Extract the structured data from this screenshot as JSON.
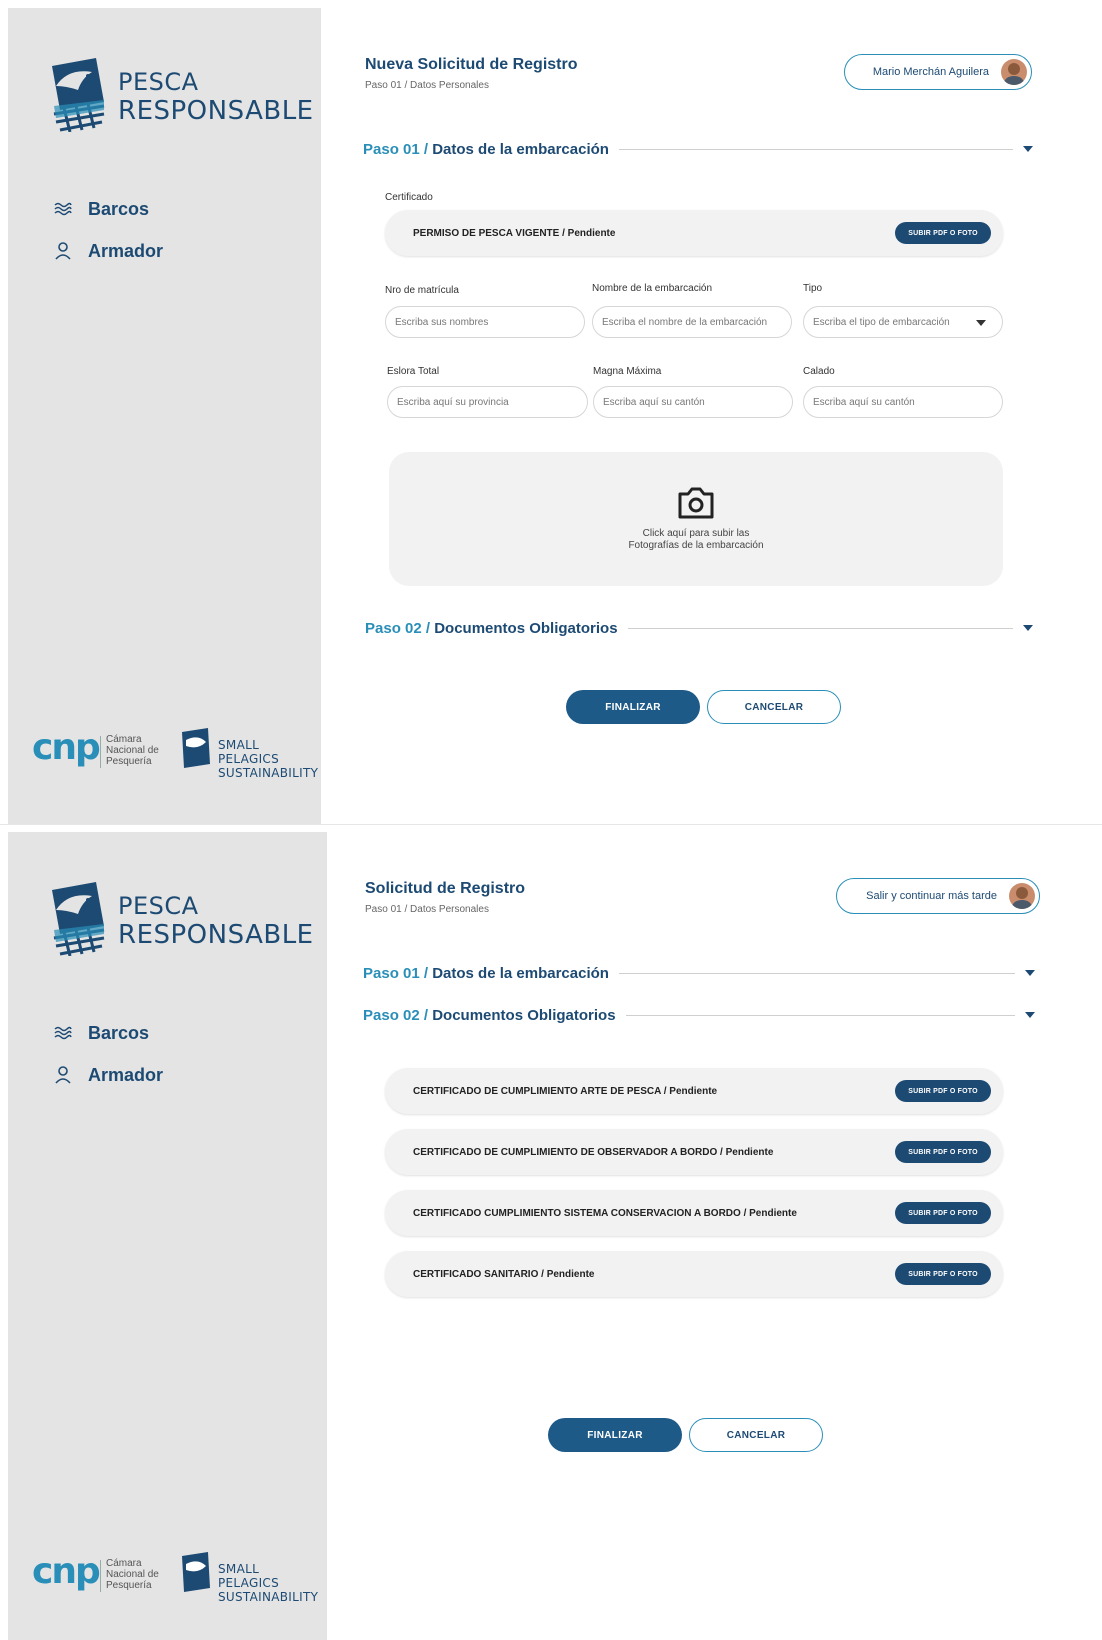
{
  "brand": {
    "logo_line1": "PESCA",
    "logo_line2": "RESPONSABLE",
    "partner1_mark": "cnp",
    "partner1_text": [
      "Cámara",
      "Nacional de",
      "Pesquería"
    ],
    "partner2_text": [
      "SMALL PELAGICS",
      "SUSTAINABILITY"
    ]
  },
  "nav": [
    {
      "label": "Barcos",
      "icon": "waves-icon"
    },
    {
      "label": "Armador",
      "icon": "user-icon"
    }
  ],
  "screen1": {
    "title": "Nueva Solicitud de Registro",
    "breadcrumb": "Paso 01 / Datos Personales",
    "user_name": "Mario Merchán Aguilera",
    "step1": {
      "step": "Paso 01 / ",
      "title": "Datos de la embarcación"
    },
    "certificado_label": "Certificado",
    "certificado_row": "PERMISO DE PESCA VIGENTE / Pendiente",
    "upload_label": "SUBIR PDF O FOTO",
    "fields": {
      "matricula": {
        "label": "Nro de matrícula",
        "placeholder": "Escriba sus nombres"
      },
      "nombre": {
        "label": "Nombre de la embarcación",
        "placeholder": "Escriba el nombre de la embarcación"
      },
      "tipo": {
        "label": "Tipo",
        "placeholder": "Escriba el tipo de embarcación"
      },
      "eslora": {
        "label": "Eslora Total",
        "placeholder": "Escriba aquí su provincia"
      },
      "magna": {
        "label": "Magna Máxima",
        "placeholder": "Escriba aquí su cantón"
      },
      "calado": {
        "label": "Calado",
        "placeholder": "Escriba aquí su cantón"
      }
    },
    "photo_line1": "Click aquí para subir las",
    "photo_line2": "Fotografías de la embarcación",
    "step2": {
      "step": "Paso 02 / ",
      "title": "Documentos Obligatorios"
    },
    "finalizar": "FINALIZAR",
    "cancelar": "CANCELAR"
  },
  "screen2": {
    "title": "Solicitud de Registro",
    "breadcrumb": "Paso 01 / Datos Personales",
    "exit_label": "Salir y continuar más tarde",
    "step1": {
      "step": "Paso 01 / ",
      "title": "Datos de la embarcación"
    },
    "step2": {
      "step": "Paso 02 / ",
      "title": "Documentos Obligatorios"
    },
    "documents": [
      {
        "label": "CERTIFICADO DE CUMPLIMIENTO ARTE DE PESCA / Pendiente",
        "action": "SUBIR PDF O FOTO"
      },
      {
        "label": "CERTIFICADO DE CUMPLIMIENTO DE OBSERVADOR A BORDO / Pendiente",
        "action": "SUBIR PDF O FOTO"
      },
      {
        "label": "CERTIFICADO CUMPLIMIENTO SISTEMA CONSERVACION A BORDO / Pendiente",
        "action": "SUBIR PDF O FOTO"
      },
      {
        "label": "CERTIFICADO SANITARIO / Pendiente",
        "action": "SUBIR PDF O FOTO"
      }
    ],
    "finalizar": "FINALIZAR",
    "cancelar": "CANCELAR"
  },
  "colors": {
    "brand_dark": "#1d4a73",
    "brand_accent": "#2a8fb8",
    "sidebar_bg": "#e4e4e4",
    "row_bg": "#f2f2f2"
  }
}
